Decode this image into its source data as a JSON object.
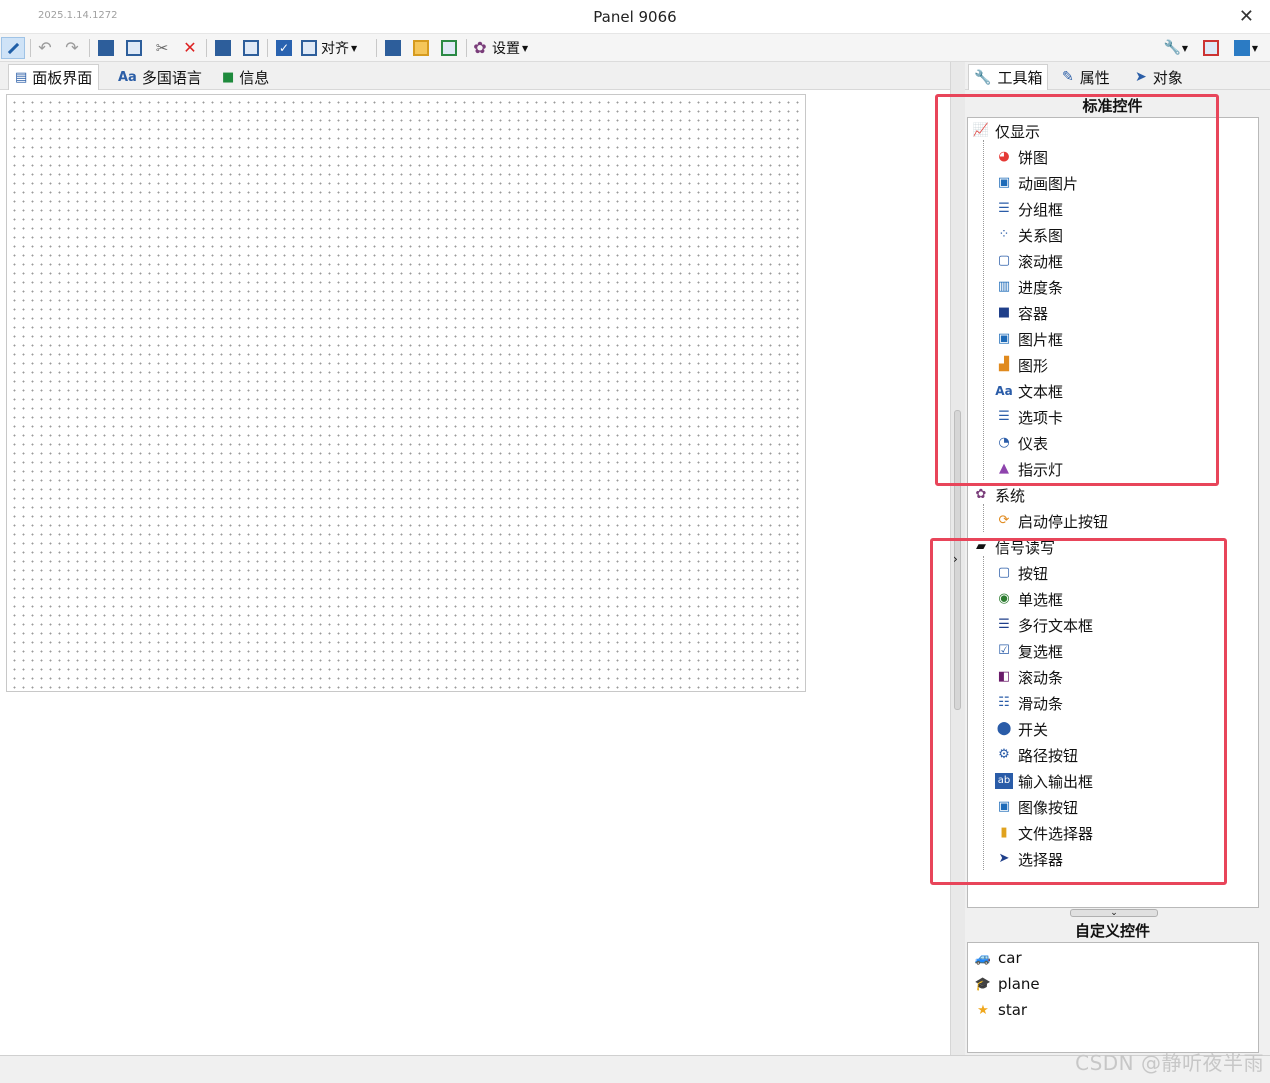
{
  "window": {
    "version": "2025.1.14.1272",
    "title": "Panel 9066",
    "close_glyph": "✕"
  },
  "toolbar": {
    "align_label": "对齐",
    "settings_label": "设置",
    "glyphs": {
      "undo": "↶",
      "redo": "↷",
      "scissors": "✂",
      "delete": "✕",
      "check": "✓",
      "gear": "✿",
      "wrench": "🔧"
    }
  },
  "left_tabs": [
    {
      "label": "面板界面",
      "icon": "panel-icon"
    },
    {
      "label": "多国语言",
      "icon_text": "Aa"
    },
    {
      "label": "信息",
      "icon": "message-icon"
    }
  ],
  "right_tabs": [
    {
      "label": "工具箱",
      "icon": "wrench-icon"
    },
    {
      "label": "属性",
      "icon": "edit-icon"
    },
    {
      "label": "对象",
      "icon": "pointer-icon"
    }
  ],
  "standard_controls": {
    "header": "标准控件",
    "groups": [
      {
        "label": "仅显示",
        "items": [
          "饼图",
          "动画图片",
          "分组框",
          "关系图",
          "滚动框",
          "进度条",
          "容器",
          "图片框",
          "图形",
          "文本框",
          "选项卡",
          "仪表",
          "指示灯"
        ]
      },
      {
        "label": "系统",
        "items": [
          "启动停止按钮"
        ]
      },
      {
        "label": "信号读写",
        "items": [
          "按钮",
          "单选框",
          "多行文本框",
          "复选框",
          "滚动条",
          "滑动条",
          "开关",
          "路径按钮",
          "输入输出框",
          "图像按钮",
          "文件选择器",
          "选择器"
        ]
      }
    ]
  },
  "custom_controls": {
    "header": "自定义控件",
    "items": [
      "car",
      "plane",
      "star"
    ]
  },
  "watermark": "CSDN @静听夜半雨",
  "colors": {
    "highlight_box": "#e8455a",
    "accent": "#2b5ea7"
  }
}
